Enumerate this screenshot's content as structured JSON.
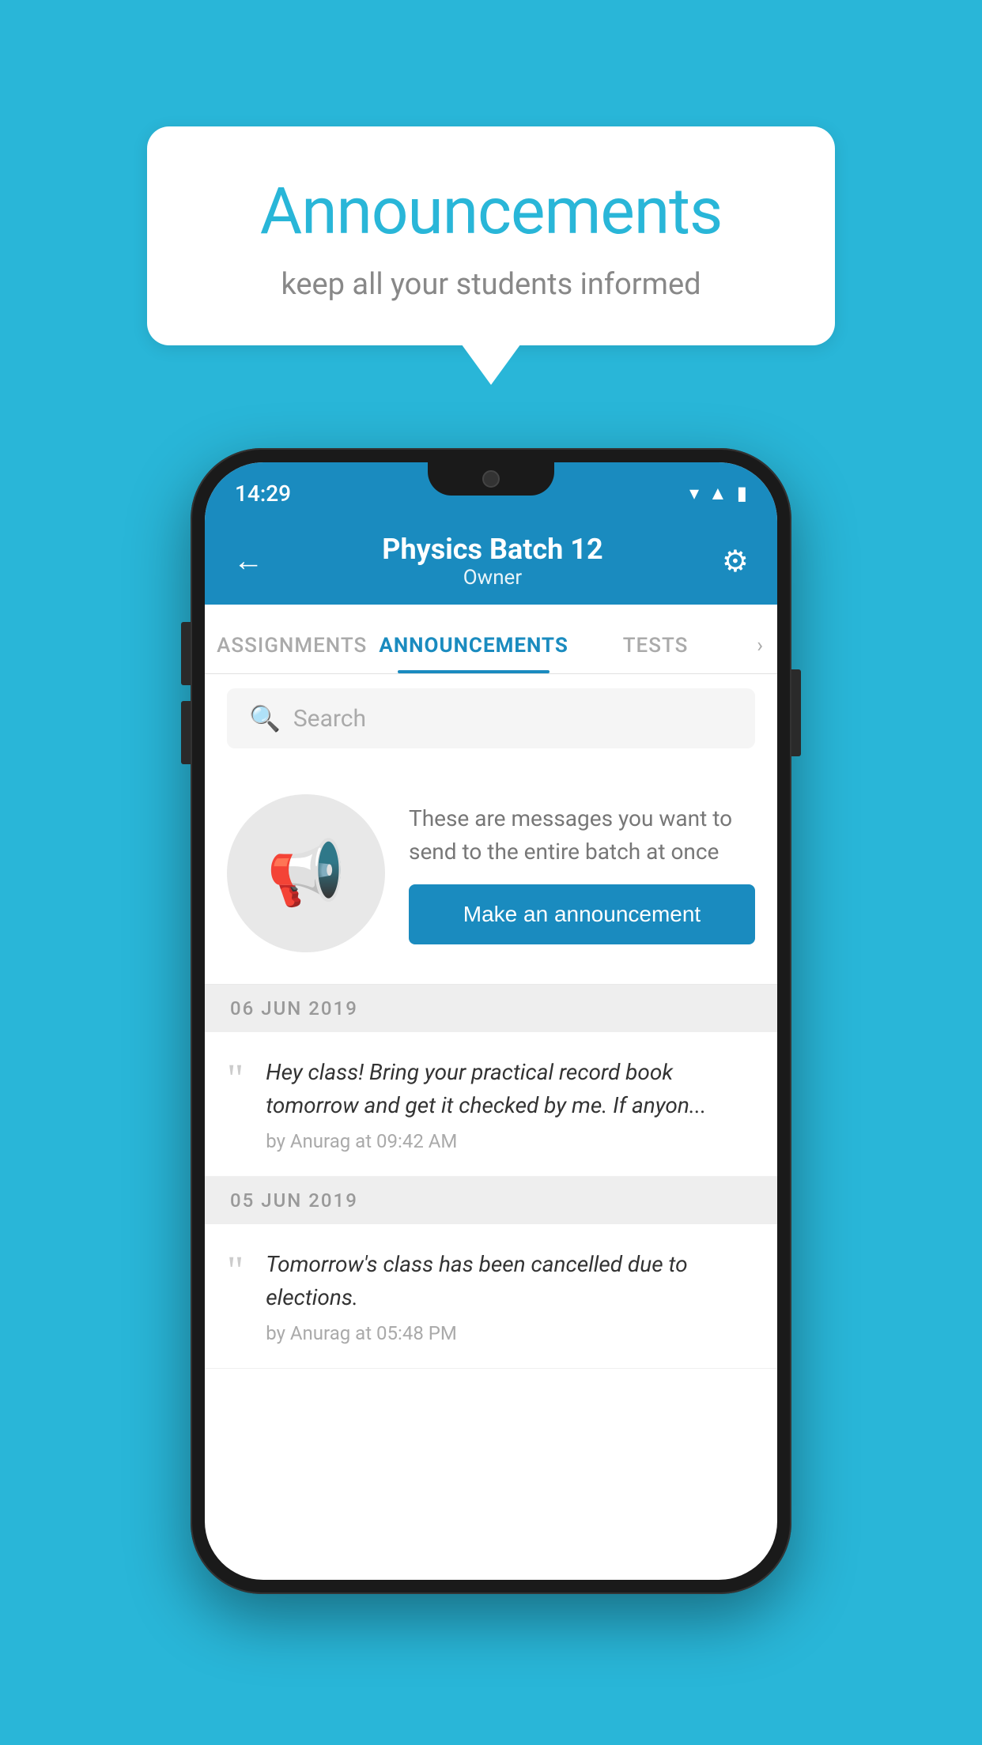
{
  "background_color": "#29b6d8",
  "speech_bubble": {
    "title": "Announcements",
    "subtitle": "keep all your students informed"
  },
  "phone": {
    "status_bar": {
      "time": "14:29"
    },
    "header": {
      "title": "Physics Batch 12",
      "subtitle": "Owner",
      "back_label": "←",
      "settings_label": "⚙"
    },
    "tabs": [
      {
        "label": "ASSIGNMENTS",
        "active": false
      },
      {
        "label": "ANNOUNCEMENTS",
        "active": true
      },
      {
        "label": "TESTS",
        "active": false
      },
      {
        "label": "›",
        "active": false
      }
    ],
    "search": {
      "placeholder": "Search"
    },
    "promo": {
      "description": "These are messages you want to send to the entire batch at once",
      "button_label": "Make an announcement"
    },
    "announcements": [
      {
        "date": "06  JUN  2019",
        "message": "Hey class! Bring your practical record book tomorrow and get it checked by me. If anyon...",
        "meta": "by Anurag at 09:42 AM"
      },
      {
        "date": "05  JUN  2019",
        "message": "Tomorrow's class has been cancelled due to elections.",
        "meta": "by Anurag at 05:48 PM"
      }
    ]
  }
}
